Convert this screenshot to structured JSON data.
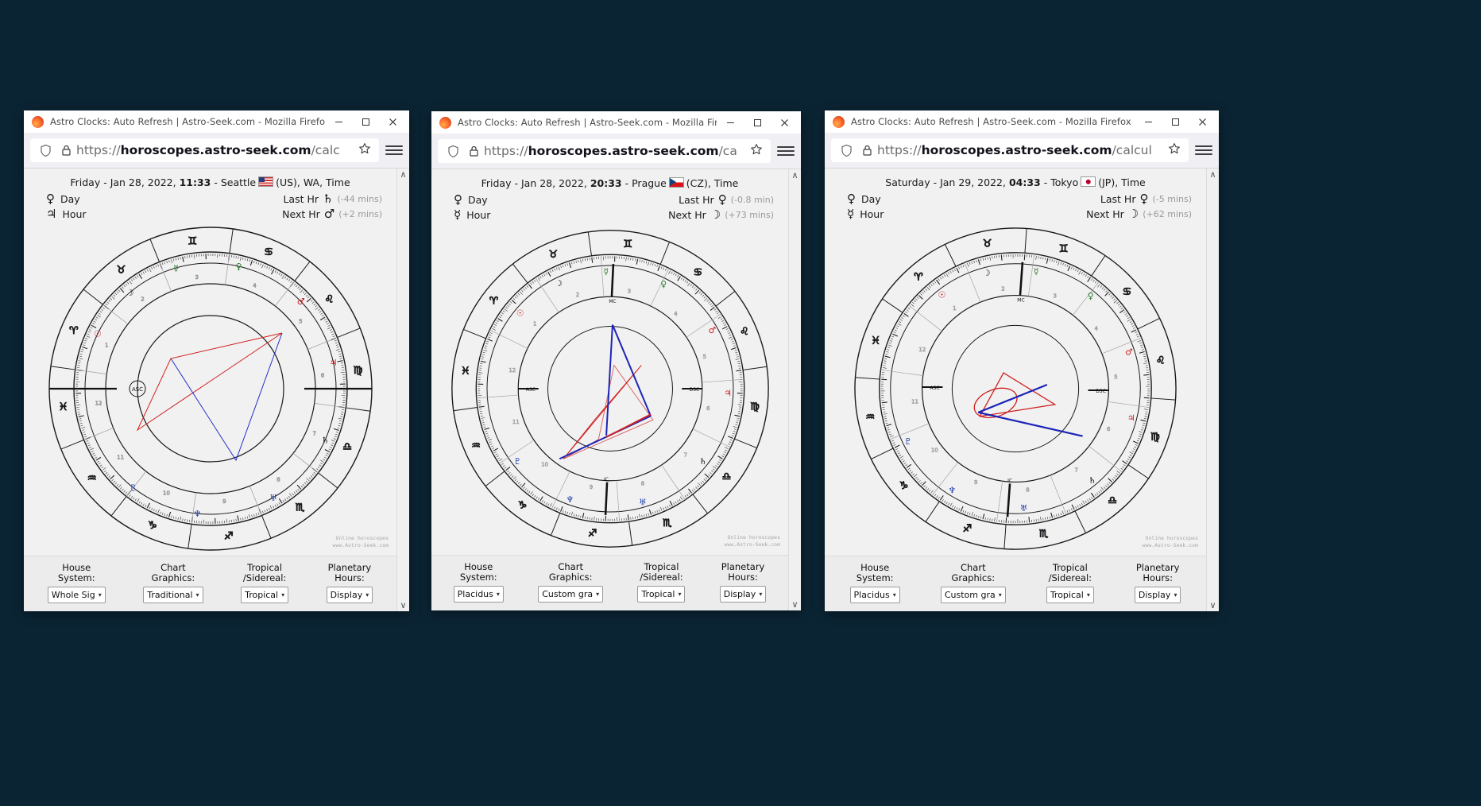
{
  "browser": {
    "window_title": "Astro Clocks: Auto Refresh | Astro-Seek.com - Mozilla Firefox",
    "minimize_label": "—",
    "maximize_label": "□",
    "close_label": "✕",
    "scroll_up_label": "∧",
    "scroll_down_label": "∨"
  },
  "windows": [
    {
      "url_prefix": "https://",
      "url_bold": "horoscopes.astro-seek.com",
      "url_suffix": "/calc",
      "date": {
        "weekday": "Friday",
        "sep1": " - ",
        "date": "Jan 28, 2022,",
        "time": "11:33",
        "sep2": " - ",
        "city": "Seattle",
        "flag": "flag-us",
        "country": "(US), WA, Time"
      },
      "day_ruler": {
        "glyph": "♀",
        "label": "Day"
      },
      "hour_ruler": {
        "glyph": "♃",
        "label": "Hour"
      },
      "last_hour": {
        "label": "Last Hr",
        "glyph": "♄",
        "mins": "(-44 mins)"
      },
      "next_hour": {
        "label": "Next Hr",
        "glyph": "♂",
        "mins": "(+2 mins)"
      },
      "credit": "Online horoscopes\nwww.Astro-Seek.com",
      "controls": [
        {
          "label": "House\nSystem:",
          "value": "Whole Sig"
        },
        {
          "label": "Chart\nGraphics:",
          "value": "Traditional"
        },
        {
          "label": "Tropical\n/Sidereal:",
          "value": "Tropical"
        },
        {
          "label": "Planetary\nHours:",
          "value": "Display"
        }
      ]
    },
    {
      "url_prefix": "https://",
      "url_bold": "horoscopes.astro-seek.com",
      "url_suffix": "/ca",
      "date": {
        "weekday": "Friday",
        "sep1": " - ",
        "date": "Jan 28, 2022,",
        "time": "20:33",
        "sep2": " - ",
        "city": "Prague",
        "flag": "flag-cz",
        "country": "(CZ), Time"
      },
      "day_ruler": {
        "glyph": "♀",
        "label": "Day"
      },
      "hour_ruler": {
        "glyph": "☿",
        "label": "Hour"
      },
      "last_hour": {
        "label": "Last Hr",
        "glyph": "♀",
        "mins": "(-0.8 min)"
      },
      "next_hour": {
        "label": "Next Hr",
        "glyph": "☽",
        "mins": "(+73 mins)"
      },
      "credit": "Online horoscopes\nwww.Astro-Seek.com",
      "controls": [
        {
          "label": "House\nSystem:",
          "value": "Placidus"
        },
        {
          "label": "Chart\nGraphics:",
          "value": "Custom gra"
        },
        {
          "label": "Tropical\n/Sidereal:",
          "value": "Tropical"
        },
        {
          "label": "Planetary\nHours:",
          "value": "Display"
        }
      ]
    },
    {
      "url_prefix": "https://",
      "url_bold": "horoscopes.astro-seek.com",
      "url_suffix": "/calcul",
      "date": {
        "weekday": "Saturday",
        "sep1": " - ",
        "date": "Jan 29, 2022,",
        "time": "04:33",
        "sep2": " - ",
        "city": "Tokyo",
        "flag": "flag-jp",
        "country": "(JP), Time"
      },
      "day_ruler": {
        "glyph": "♀",
        "label": "Day"
      },
      "hour_ruler": {
        "glyph": "☿",
        "label": "Hour"
      },
      "last_hour": {
        "label": "Last Hr",
        "glyph": "♀",
        "mins": "(-5 mins)"
      },
      "next_hour": {
        "label": "Next Hr",
        "glyph": "☽",
        "mins": "(+62 mins)"
      },
      "credit": "Online horoscopes\nwww.Astro-Seek.com",
      "controls": [
        {
          "label": "House\nSystem:",
          "value": "Placidus"
        },
        {
          "label": "Chart\nGraphics:",
          "value": "Custom gra"
        },
        {
          "label": "Tropical\n/Sidereal:",
          "value": "Tropical"
        },
        {
          "label": "Planetary\nHours:",
          "value": "Display"
        }
      ]
    }
  ],
  "zodiac_signs": [
    "♈",
    "♉",
    "♊",
    "♋",
    "♌",
    "♍",
    "♎",
    "♏",
    "♐",
    "♑",
    "♒",
    "♓"
  ],
  "planet_glyphs": [
    "☉",
    "☽",
    "☿",
    "♀",
    "♂",
    "♃",
    "♄",
    "♅",
    "♆",
    "♇"
  ],
  "house_numbers": [
    "1",
    "2",
    "3",
    "4",
    "5",
    "6",
    "7",
    "8",
    "9",
    "10",
    "11",
    "12"
  ],
  "chart_labels": {
    "asc": "ASC",
    "mc": "MC",
    "dsc": "DSC",
    "ic": "IC"
  },
  "colors": {
    "desktop_bg": "#0b2434",
    "window_bg": "#f0f0f0",
    "page_bg": "#f1f1f1",
    "chart_line": "#1a1a1a",
    "aspect_red": "#d02020",
    "aspect_blue": "#2030c8",
    "sign_fire": "#c81e1e",
    "sign_earth": "#2c7a2c",
    "sign_air": "#b88a10",
    "sign_water": "#1e3fa8"
  }
}
